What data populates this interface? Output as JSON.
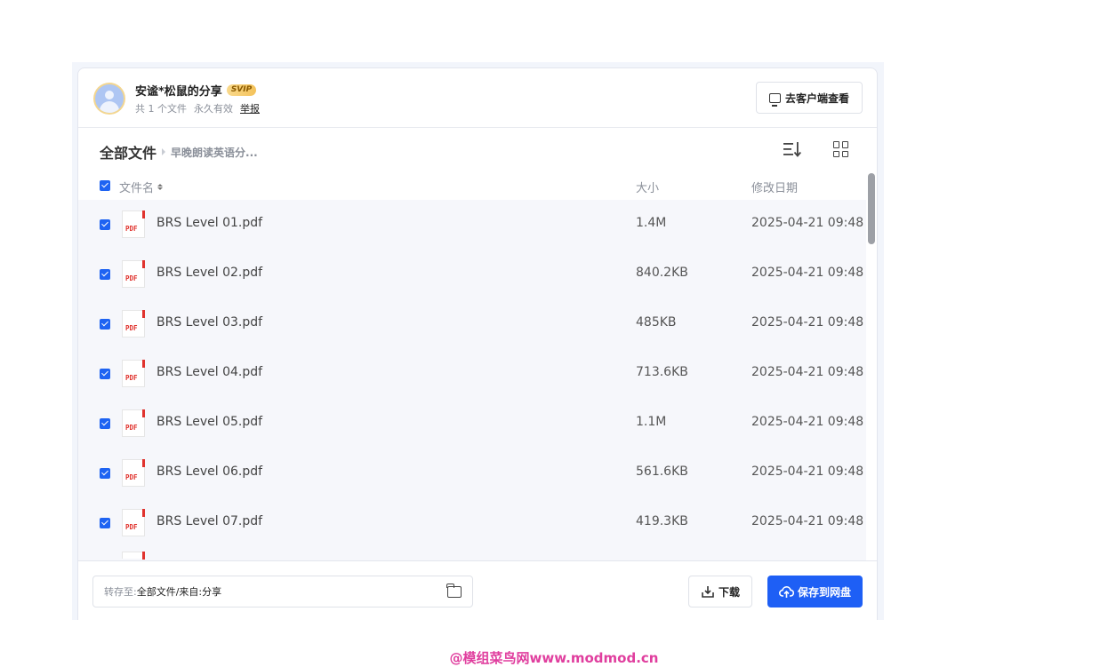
{
  "header": {
    "owner_name": "安谧*松鼠的分享",
    "badge": "SVIP",
    "file_count": "共 1 个文件",
    "validity": "永久有效",
    "report_label": "举报",
    "client_button_label": "去客户端查看"
  },
  "breadcrumb": {
    "root": "全部文件",
    "current": "早晚朗读英语分..."
  },
  "table": {
    "col_name": "文件名",
    "col_size": "大小",
    "col_date": "修改日期",
    "icon_text": "PDF",
    "rows": [
      {
        "name": "BRS Level 01.pdf",
        "size": "1.4M",
        "date": "2025-04-21 09:48"
      },
      {
        "name": "BRS Level 02.pdf",
        "size": "840.2KB",
        "date": "2025-04-21 09:48"
      },
      {
        "name": "BRS Level 03.pdf",
        "size": "485KB",
        "date": "2025-04-21 09:48"
      },
      {
        "name": "BRS Level 04.pdf",
        "size": "713.6KB",
        "date": "2025-04-21 09:48"
      },
      {
        "name": "BRS Level 05.pdf",
        "size": "1.1M",
        "date": "2025-04-21 09:48"
      },
      {
        "name": "BRS Level 06.pdf",
        "size": "561.6KB",
        "date": "2025-04-21 09:48"
      },
      {
        "name": "BRS Level 07.pdf",
        "size": "419.3KB",
        "date": "2025-04-21 09:48"
      }
    ]
  },
  "footer": {
    "path_label": "转存至:",
    "path_value": "全部文件/来自:分享",
    "download_label": "下载",
    "save_label": "保存到网盘"
  },
  "watermark": "@模组菜鸟网www.modmod.cn",
  "colors": {
    "accent": "#1e5ff5",
    "pdf_red": "#e0332e",
    "watermark": "#e03e9e"
  }
}
